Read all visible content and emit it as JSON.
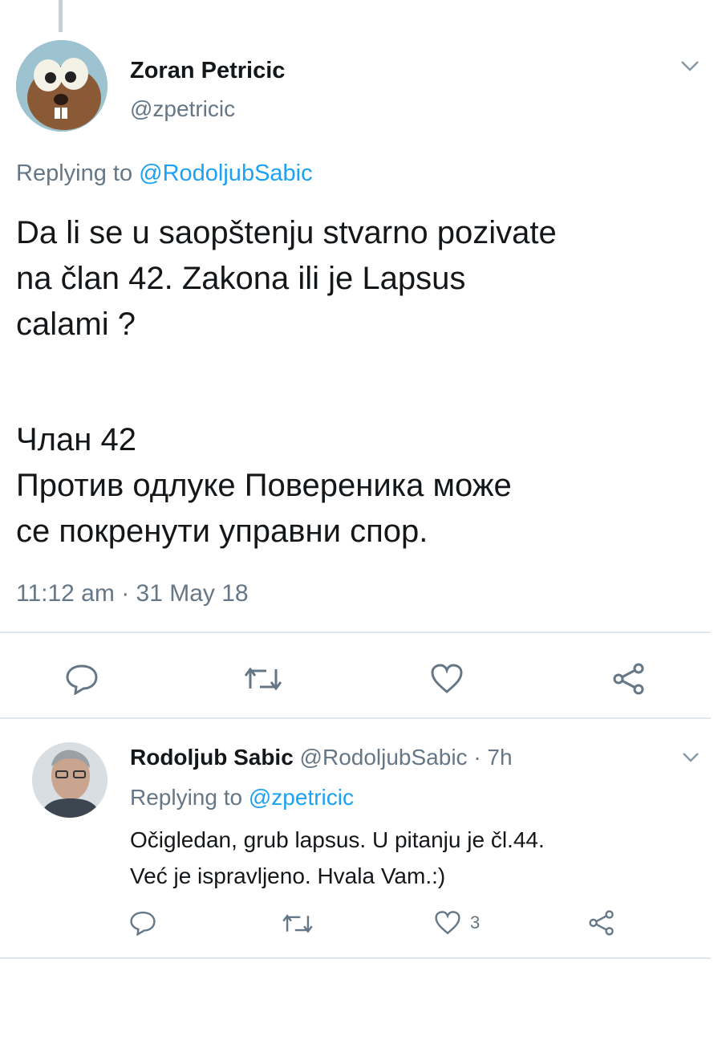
{
  "main_tweet": {
    "author_name": "Zoran Petricic",
    "author_handle": "@zpetricic",
    "replying_prefix": "Replying to ",
    "replying_to": "@RodoljubSabic",
    "text": "Da li se u saopštenju stvarno pozivate\nna član 42. Zakona ili je Lapsus\ncalami ?",
    "quote_text": "Члан 42\nПротив одлуке Повереника може\nсе покренути управни спор.",
    "timestamp": "11:12 am · 31 May 18",
    "actions": {
      "reply_icon": "reply-icon",
      "retweet_icon": "retweet-icon",
      "like_icon": "like-icon",
      "share_icon": "share-icon"
    }
  },
  "reply_tweet": {
    "author_name": "Rodoljub Sabic",
    "author_meta": " @RodoljubSabic · 7h",
    "replying_prefix": "Replying to ",
    "replying_to": "@zpetricic",
    "text": "Očigledan, grub lapsus. U pitanju je čl.44.\nVeć je ispravljeno. Hvala Vam.:)",
    "like_count": "3"
  },
  "colors": {
    "accent": "#1da1f2",
    "secondary_text": "#657786",
    "divider": "#e1e8ed"
  }
}
